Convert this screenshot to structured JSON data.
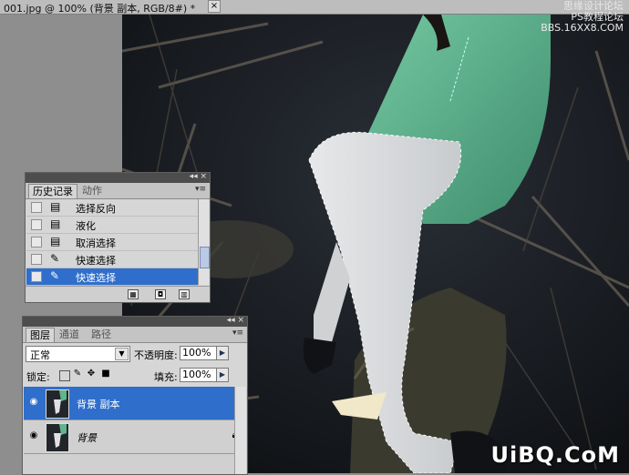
{
  "document": {
    "title": "001.jpg @ 100% (背景 副本, RGB/8#) *",
    "close": "×",
    "watermark_line1": "思缘设计论坛",
    "watermark_line2": "PS教程论坛",
    "watermark_line3": "BBS.16XX8.COM",
    "brand": "UiBQ.CoM"
  },
  "history_panel": {
    "tabs": [
      "历史记录",
      "动作"
    ],
    "collapse": "◂◂ ×",
    "menu": "▾≡",
    "items": [
      {
        "label": "选择反向",
        "icon": "document-icon"
      },
      {
        "label": "液化",
        "icon": "document-icon"
      },
      {
        "label": "取消选择",
        "icon": "document-icon"
      },
      {
        "label": "快速选择",
        "icon": "quick-select-icon"
      },
      {
        "label": "快速选择",
        "icon": "quick-select-icon",
        "selected": true
      }
    ]
  },
  "layers_panel": {
    "tabs": [
      "图层",
      "通道",
      "路径"
    ],
    "collapse": "◂◂ ×",
    "menu": "▾≡",
    "blend_mode": "正常",
    "opacity_label": "不透明度:",
    "opacity_value": "100%",
    "lock_label": "锁定:",
    "fill_label": "填充:",
    "fill_value": "100%",
    "layers": [
      {
        "name": "背景 副本",
        "selected": true
      },
      {
        "name": "背景",
        "italic": true,
        "locked": true
      }
    ]
  },
  "colors": {
    "selection": "#2f6ecb",
    "panel": "#d6d6d6",
    "bar": "#4d4d4d"
  }
}
